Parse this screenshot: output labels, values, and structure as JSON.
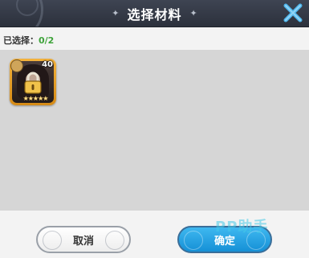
{
  "header": {
    "title": "选择材料",
    "sparkle_left": "✦",
    "sparkle_right": "✦"
  },
  "selection": {
    "label": "已选择：",
    "count": "0/2"
  },
  "items": [
    {
      "level": "40",
      "stars": "★★★★★",
      "locked": true,
      "icon": "lock-icon"
    }
  ],
  "buttons": {
    "cancel_label": "取消",
    "confirm_label": "确定"
  },
  "watermark": "PP助手",
  "colors": {
    "header_bg": "#2c313c",
    "count_green": "#3ea33a",
    "confirm_blue": "#1590d6",
    "card_gold": "#f4b33d",
    "panel_bg": "#d6d6d6"
  }
}
